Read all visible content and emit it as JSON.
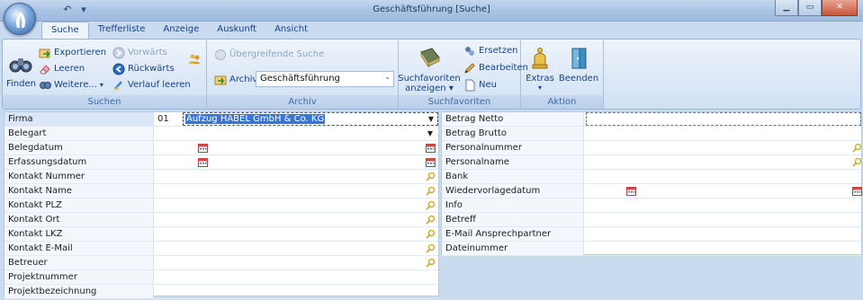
{
  "window": {
    "title": "Geschäftsführung [Suche]"
  },
  "tabs": [
    "Suche",
    "Trefferliste",
    "Anzeige",
    "Auskunft",
    "Ansicht"
  ],
  "ribbon": {
    "suchen": {
      "caption": "Suchen",
      "finden": "Finden",
      "exportieren": "Exportieren",
      "leeren": "Leeren",
      "weitere": "Weitere...",
      "vorwaerts": "Vorwärts",
      "rueckwaerts": "Rückwärts",
      "verlauf": "Verlauf leeren"
    },
    "archiv": {
      "caption": "Archiv",
      "uebergreifend": "Übergreifende Suche",
      "archiv_label": "Archiv",
      "archiv_value": "Geschäftsführung"
    },
    "suchfavoriten": {
      "caption": "Suchfavoriten",
      "anzeigen_line1": "Suchfavoriten",
      "anzeigen_line2": "anzeigen ▾",
      "ersetzen": "Ersetzen",
      "bearbeiten": "Bearbeiten",
      "neu": "Neu"
    },
    "aktion": {
      "caption": "Aktion",
      "extras": "Extras",
      "beenden": "Beenden"
    }
  },
  "left_fields": [
    {
      "label": "Firma",
      "code": "01",
      "value": "Aufzug HABEL GmbH & Co. KG",
      "type": "dropdown-selected"
    },
    {
      "label": "Belegart",
      "code": "",
      "value": "",
      "type": "dropdown"
    },
    {
      "label": "Belegdatum",
      "code": "",
      "value": "",
      "type": "date-range"
    },
    {
      "label": "Erfassungsdatum",
      "code": "",
      "value": "",
      "type": "date-range"
    },
    {
      "label": "Kontakt Nummer",
      "code": "",
      "value": "",
      "type": "lookup"
    },
    {
      "label": "Kontakt Name",
      "code": "",
      "value": "",
      "type": "lookup"
    },
    {
      "label": "Kontakt PLZ",
      "code": "",
      "value": "",
      "type": "lookup"
    },
    {
      "label": "Kontakt Ort",
      "code": "",
      "value": "",
      "type": "lookup"
    },
    {
      "label": "Kontakt LKZ",
      "code": "",
      "value": "",
      "type": "lookup"
    },
    {
      "label": "Kontakt E-Mail",
      "code": "",
      "value": "",
      "type": "lookup"
    },
    {
      "label": "Betreuer",
      "code": "",
      "value": "",
      "type": "lookup"
    },
    {
      "label": "Projektnummer",
      "code": "",
      "value": "",
      "type": "text"
    },
    {
      "label": "Projektbezeichnung",
      "code": "",
      "value": "",
      "type": "text"
    }
  ],
  "right_fields": [
    {
      "label": "Betrag Netto",
      "type": "text-focused"
    },
    {
      "label": "Betrag Brutto",
      "type": "text"
    },
    {
      "label": "Personalnummer",
      "type": "lookup"
    },
    {
      "label": "Personalname",
      "type": "lookup"
    },
    {
      "label": "Bank",
      "type": "text"
    },
    {
      "label": "Wiedervorlagedatum",
      "type": "date-range"
    },
    {
      "label": "Info",
      "type": "text"
    },
    {
      "label": "Betreff",
      "type": "text"
    },
    {
      "label": "E-Mail Ansprechpartner (exte...",
      "type": "text"
    },
    {
      "label": "Dateinummer",
      "type": "text"
    }
  ],
  "colors": {
    "accent": "#15428b",
    "ribbon": "#dce8f6",
    "selection": "#dbe7f6"
  }
}
